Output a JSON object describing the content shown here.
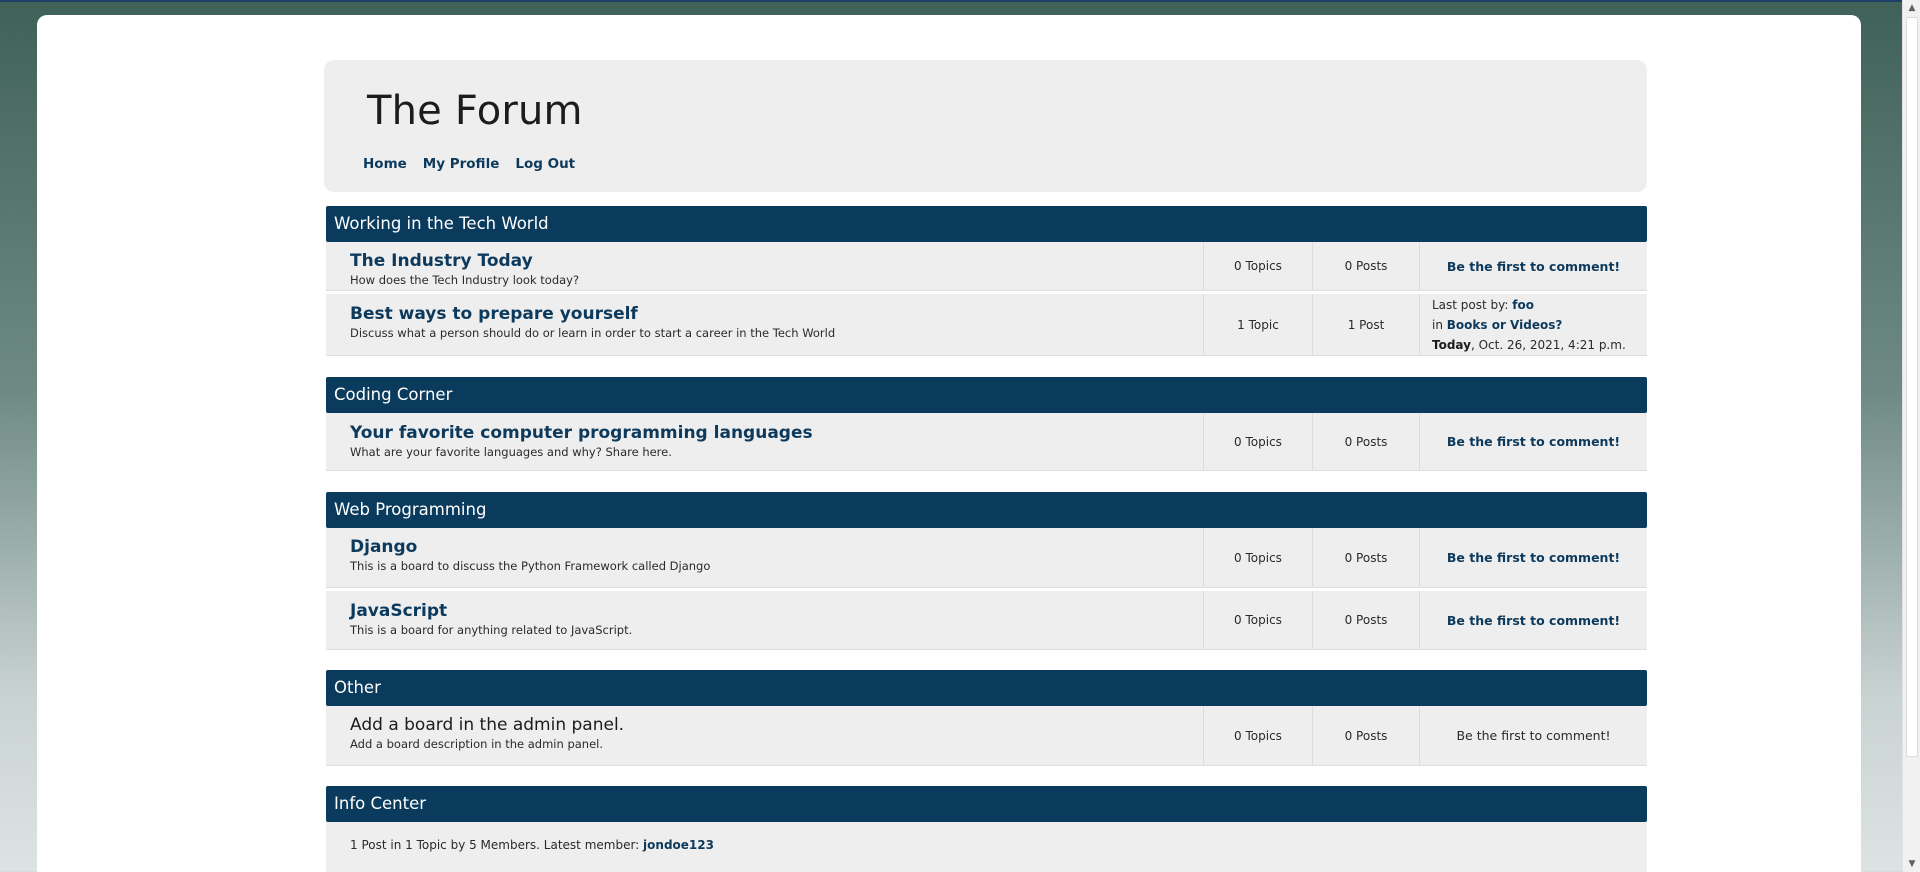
{
  "site": {
    "title": "The Forum"
  },
  "nav": [
    {
      "label": "Home"
    },
    {
      "label": "My Profile"
    },
    {
      "label": "Log Out"
    }
  ],
  "categories": [
    {
      "name": "Working in the Tech World",
      "boards": [
        {
          "title": "The Industry Today",
          "description": "How does the Tech Industry look today?",
          "topics": "0 Topics",
          "posts": "0 Posts",
          "last_post": "Be the first to comment!"
        },
        {
          "title": "Best ways to prepare yourself",
          "description": "Discuss what a person should do or learn in order to start a career in the Tech World",
          "topics": "1 Topic",
          "posts": "1 Post",
          "last_post_by_label": "Last post by:",
          "last_post_user": "foo",
          "last_post_in_label": "in",
          "last_post_topic": "Books or Videos?",
          "last_post_day": "Today",
          "last_post_date": ", Oct. 26, 2021, 4:21 p.m."
        }
      ]
    },
    {
      "name": "Coding Corner",
      "boards": [
        {
          "title": "Your favorite computer programming languages",
          "description": "What are your favorite languages and why? Share here.",
          "topics": "0 Topics",
          "posts": "0 Posts",
          "last_post": "Be the first to comment!"
        }
      ]
    },
    {
      "name": "Web Programming",
      "boards": [
        {
          "title": "Django",
          "description": "This is a board to discuss the Python Framework called Django",
          "topics": "0 Topics",
          "posts": "0 Posts",
          "last_post": "Be the first to comment!"
        },
        {
          "title": "JavaScript",
          "description": "This is a board for anything related to JavaScript.",
          "topics": "0 Topics",
          "posts": "0 Posts",
          "last_post": "Be the first to comment!"
        }
      ]
    },
    {
      "name": "Other",
      "boards": [
        {
          "title": "Add a board in the admin panel.",
          "description": "Add a board description in the admin panel.",
          "topics": "0 Topics",
          "posts": "0 Posts",
          "last_post": "Be the first to comment!"
        }
      ]
    }
  ],
  "info_center": {
    "name": "Info Center",
    "stats_text": "1 Post in 1 Topic by 5 Members. Latest member: ",
    "latest_member": "jondoe123"
  }
}
